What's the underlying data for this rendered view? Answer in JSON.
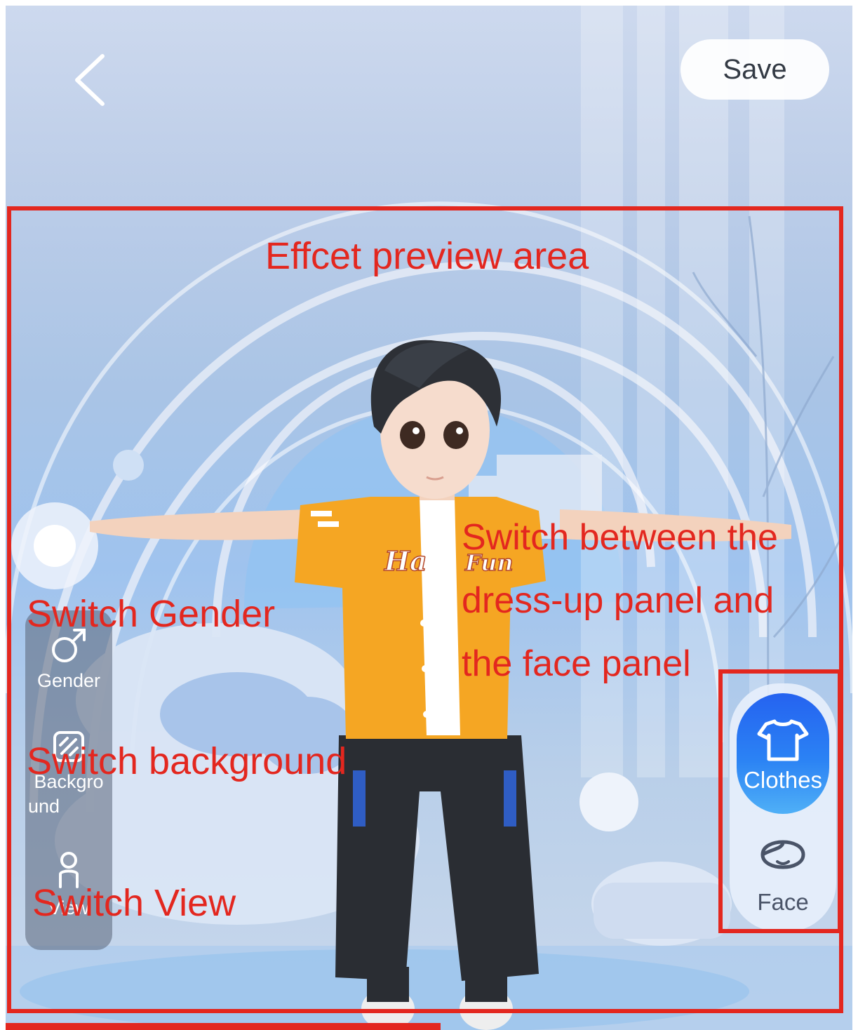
{
  "header": {
    "back_icon": "chevron-left-icon",
    "save_label": "Save"
  },
  "left_toolbar": {
    "items": [
      {
        "label": "Gender",
        "icon": "male-symbol-icon"
      },
      {
        "label_line1": "Backgro",
        "label_line2": "und",
        "icon": "background-icon"
      },
      {
        "label": "View",
        "icon": "person-icon"
      }
    ]
  },
  "right_toolbar": {
    "items": [
      {
        "label": "Clothes",
        "icon": "tshirt-icon",
        "active": true
      },
      {
        "label": "Face",
        "icon": "face-icon",
        "active": false
      }
    ]
  },
  "annotations": {
    "preview_area": "Effcet preview area",
    "switch_gender": "Switch  Gender",
    "switch_background": "Switch  background",
    "switch_view": "Switch  View",
    "switch_panel_line1": "Switch between the",
    "switch_panel_line2": "dress-up panel and",
    "switch_panel_line3": "the face panel",
    "annotation_color": "#e3271f"
  },
  "colors": {
    "active_tab": "#2563f0",
    "background": "#b9cfe9"
  }
}
